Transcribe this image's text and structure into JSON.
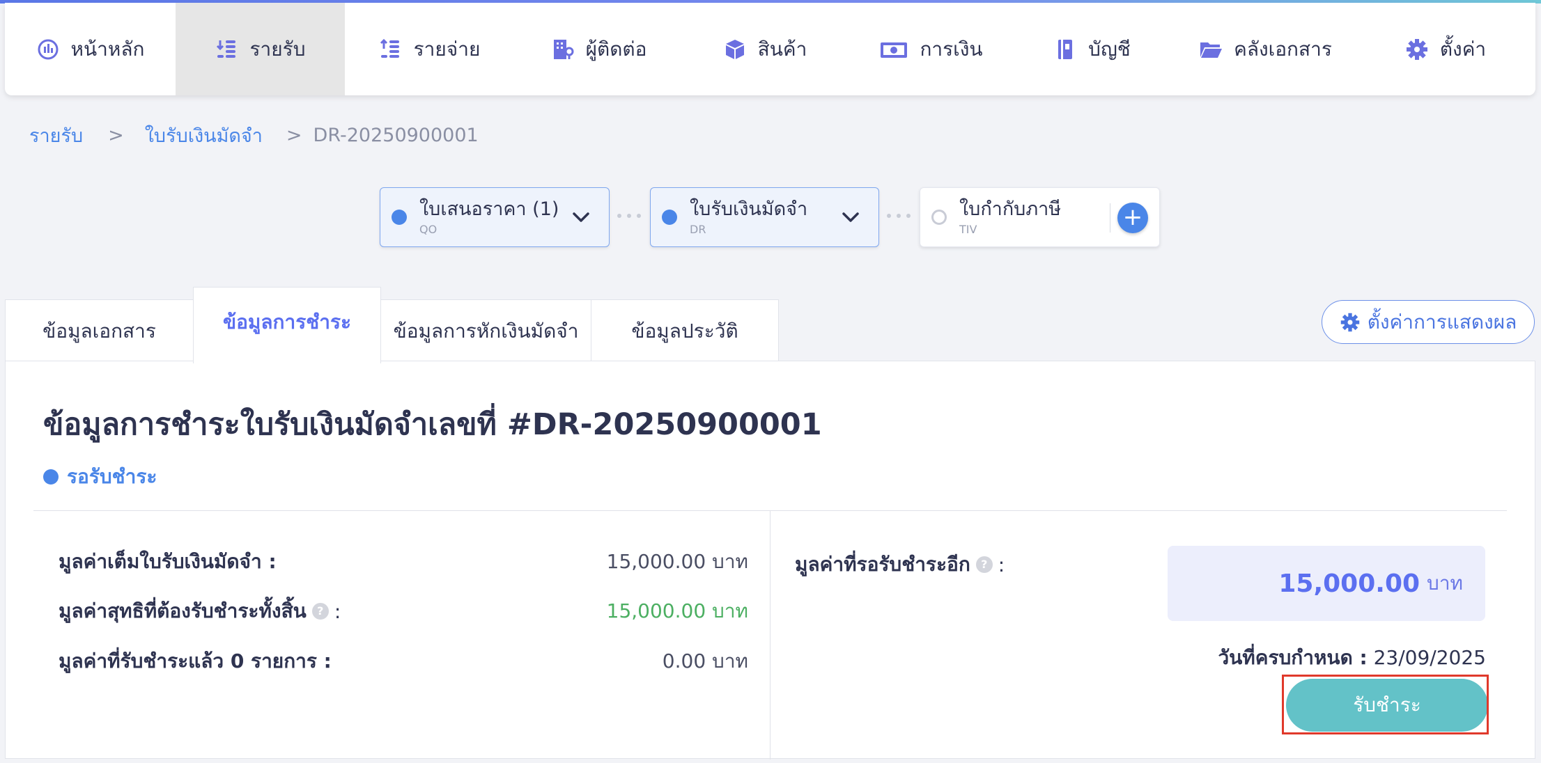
{
  "nav": {
    "items": [
      {
        "label": "หน้าหลัก",
        "icon": "dashboard-icon"
      },
      {
        "label": "รายรับ",
        "icon": "income-icon",
        "active": true
      },
      {
        "label": "รายจ่าย",
        "icon": "expense-icon"
      },
      {
        "label": "ผู้ติดต่อ",
        "icon": "contacts-icon"
      },
      {
        "label": "สินค้า",
        "icon": "box-icon"
      },
      {
        "label": "การเงิน",
        "icon": "money-icon"
      },
      {
        "label": "บัญชี",
        "icon": "ledger-icon"
      },
      {
        "label": "คลังเอกสาร",
        "icon": "folder-icon"
      },
      {
        "label": "ตั้งค่า",
        "icon": "gear-icon"
      }
    ]
  },
  "breadcrumb": {
    "items": [
      "รายรับ",
      "ใบรับเงินมัดจำ"
    ],
    "separator": ">",
    "current": "DR-20250900001"
  },
  "flow": {
    "cards": [
      {
        "title": "ใบเสนอราคา (1)",
        "code": "QO"
      },
      {
        "title": "ใบรับเงินมัดจำ",
        "code": "DR"
      },
      {
        "title": "ใบกำกับภาษี",
        "code": "TIV"
      }
    ],
    "add_label": "+"
  },
  "tabs": {
    "items": [
      "ข้อมูลเอกสาร",
      "ข้อมูลการชำระ",
      "ข้อมูลการหักเงินมัดจำ",
      "ข้อมูลประวัติ"
    ],
    "active_index": 1
  },
  "display_settings_label": "ตั้งค่าการแสดงผล",
  "payment": {
    "title": "ข้อมูลการชำระใบรับเงินมัดจำเลขที่ #DR-20250900001",
    "status": "รอรับชำระ",
    "rows": [
      {
        "label": "มูลค่าเต็มใบรับเงินมัดจำ :",
        "value": "15,000.00 บาท"
      },
      {
        "label": "มูลค่าสุทธิที่ต้องรับชำระทั้งสิ้น",
        "label_suffix": ":",
        "value": "15,000.00 บาท"
      },
      {
        "label": "มูลค่าที่รับชำระแล้ว 0 รายการ :",
        "value": "0.00 บาท"
      }
    ],
    "remaining_label": "มูลค่าที่รอรับชำระอีก",
    "remaining_suffix": ":",
    "remaining_value": "15,000.00",
    "remaining_unit": "บาท",
    "due_label": "วันที่ครบกำหนด :",
    "due_date": "23/09/2025",
    "receive_button": "รับชำระ",
    "help_glyph": "?"
  },
  "colors": {
    "accent": "#4a86e8",
    "primary_text": "#2e3350",
    "tab_active": "#5b6ff0",
    "positive": "#4caf62",
    "receive_button": "#63c2c8",
    "highlight": "#e0392b"
  }
}
